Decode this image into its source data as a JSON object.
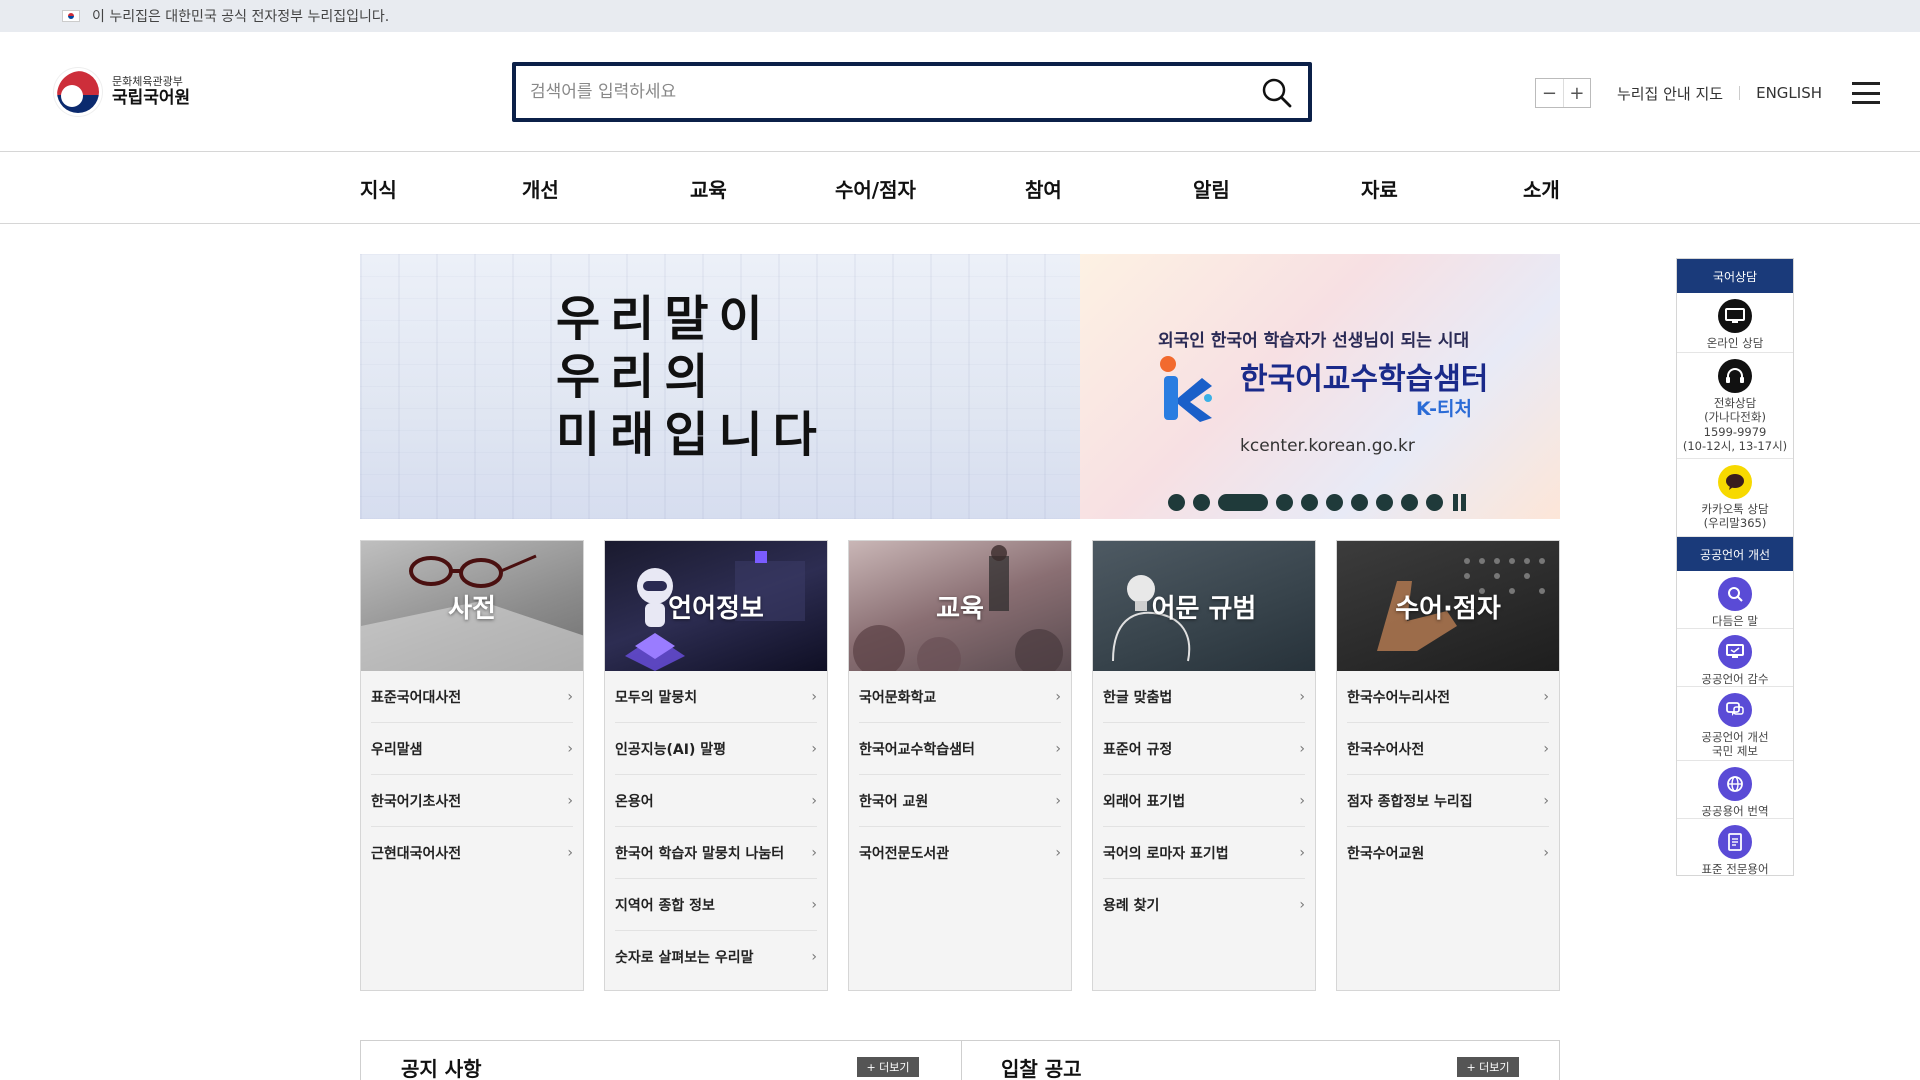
{
  "gov_banner": {
    "text": "이 누리집은 대한민국 공식 전자정부 누리집입니다."
  },
  "logo": {
    "ministry": "문화체육관광부",
    "institute": "국립국어원"
  },
  "search": {
    "placeholder": "검색어를 입력하세요"
  },
  "utility": {
    "zoom_out": "−",
    "zoom_in": "+",
    "sitemap": "누리집 안내 지도",
    "english": "ENGLISH"
  },
  "gnb": [
    "지식",
    "개선",
    "교육",
    "수어/점자",
    "참여",
    "알림",
    "자료",
    "소개"
  ],
  "banner1": {
    "line1": "우리말이",
    "line2": "우리의",
    "line3": "미래입니다"
  },
  "banner2": {
    "subtitle": "외국인 한국어 학습자가 선생님이 되는 시대",
    "title": "한국어교수학습샘터",
    "tag": "K-티처",
    "url": "kcenter.korean.go.kr"
  },
  "cards": [
    {
      "title": "사전",
      "items": [
        "표준국어대사전",
        "우리말샘",
        "한국어기초사전",
        "근현대국어사전"
      ]
    },
    {
      "title": "언어정보",
      "items": [
        "모두의 말뭉치",
        "인공지능(AI) 말평",
        "온용어",
        "한국어 학습자 말뭉치 나눔터",
        "지역어 종합 정보",
        "숫자로 살펴보는 우리말"
      ]
    },
    {
      "title": "교육",
      "items": [
        "국어문화학교",
        "한국어교수학습샘터",
        "한국어 교원",
        "국어전문도서관"
      ]
    },
    {
      "title": "어문 규범",
      "items": [
        "한글 맞춤법",
        "표준어 규정",
        "외래어 표기법",
        "국어의 로마자 표기법",
        "용례 찾기"
      ]
    },
    {
      "title": "수어·점자",
      "items": [
        "한국수어누리사전",
        "한국수어사전",
        "점자 종합정보 누리집",
        "한국수어교원"
      ]
    }
  ],
  "bottom": {
    "notice_title": "공지 사항",
    "notice_more": "+ 더보기",
    "bid_title": "입찰 공고",
    "bid_more": "+ 더보기"
  },
  "quick": {
    "consult_header": "국어상담",
    "online": "온라인 상담",
    "phone_l1": "전화상담",
    "phone_l2": "(가나다전화)",
    "phone_l3": "1599-9979",
    "phone_l4": "(10-12시, 13-17시)",
    "kakao_l1": "카카오톡 상담",
    "kakao_l2": "(우리말365)",
    "public_header": "공공언어 개선",
    "easy": "다듬은 말",
    "review": "공공언어 감수",
    "report_l1": "공공언어 개선",
    "report_l2": "국민 제보",
    "translate": "공공용어 번역",
    "terms": "표준 전문용어"
  },
  "colors": {
    "navy": "#0b2048",
    "quick_header": "#1a3a7a",
    "accent_violet": "#5a4bd6"
  }
}
